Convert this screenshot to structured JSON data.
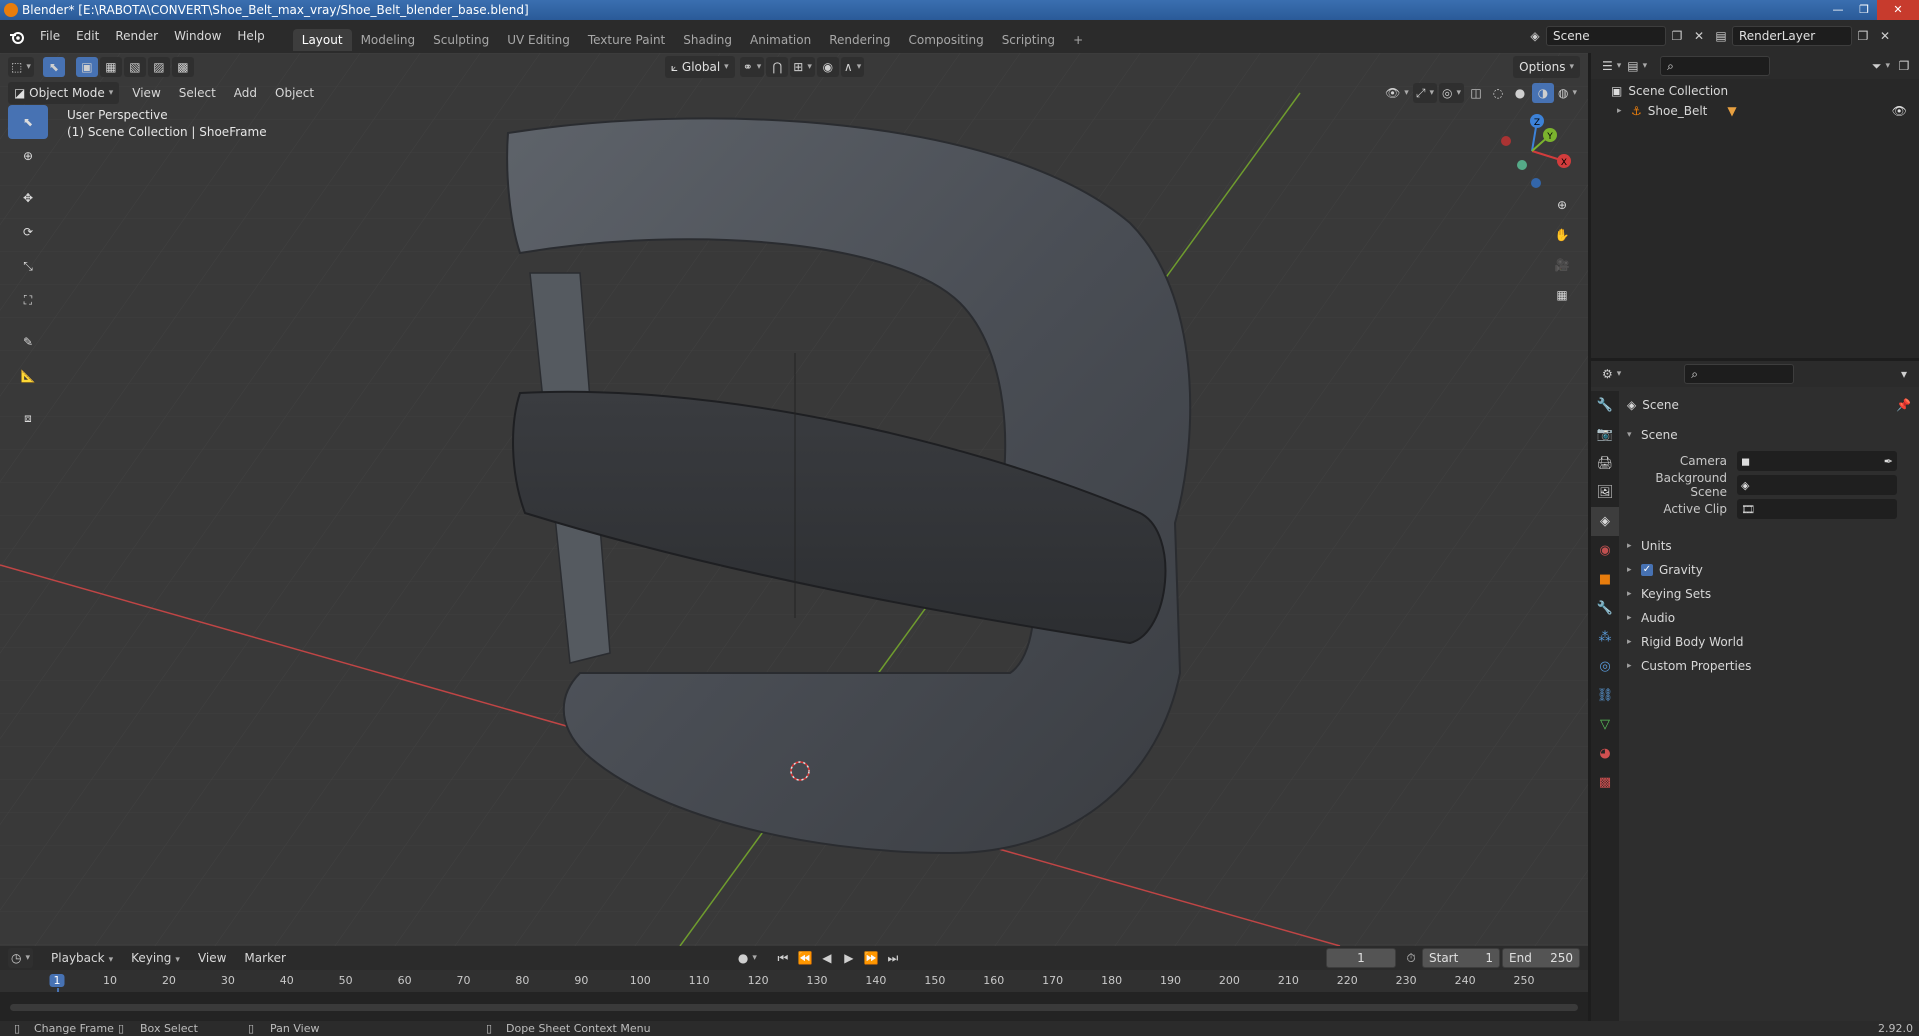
{
  "window": {
    "title": "Blender* [E:\\RABOTA\\CONVERT\\Shoe_Belt_max_vray/Shoe_Belt_blender_base.blend]",
    "controls": [
      "—",
      "❐",
      "✕"
    ]
  },
  "menu": {
    "items": [
      "File",
      "Edit",
      "Render",
      "Window",
      "Help"
    ]
  },
  "workspaces": {
    "tabs": [
      "Layout",
      "Modeling",
      "Sculpting",
      "UV Editing",
      "Texture Paint",
      "Shading",
      "Animation",
      "Rendering",
      "Compositing",
      "Scripting"
    ],
    "active": "Layout",
    "add": "+"
  },
  "scene_selector": {
    "value": "Scene"
  },
  "renderlayer_selector": {
    "value": "RenderLayer"
  },
  "viewport": {
    "mode": "Object Mode",
    "menus": [
      "View",
      "Select",
      "Add",
      "Object"
    ],
    "transform_orientation": "Global",
    "options_label": "Options",
    "info_line1": "User Perspective",
    "info_line2": "(1) Scene Collection | ShoeFrame"
  },
  "outliner": {
    "root": "Scene Collection",
    "items": [
      {
        "name": "Shoe_Belt"
      }
    ]
  },
  "properties": {
    "context": "Scene",
    "panel_title": "Scene",
    "fields": [
      {
        "label": "Camera",
        "value": ""
      },
      {
        "label": "Background Scene",
        "value": ""
      },
      {
        "label": "Active Clip",
        "value": ""
      }
    ],
    "collapsed_panels": [
      "Units",
      "Gravity",
      "Keying Sets",
      "Audio",
      "Rigid Body World",
      "Custom Properties"
    ],
    "gravity_checked": true
  },
  "timeline": {
    "menus": [
      "Playback",
      "Keying",
      "View",
      "Marker"
    ],
    "current_frame": "1",
    "start_label": "Start",
    "start_value": "1",
    "end_label": "End",
    "end_value": "250",
    "ticks": [
      "1",
      "10",
      "20",
      "30",
      "40",
      "50",
      "60",
      "70",
      "80",
      "90",
      "100",
      "110",
      "120",
      "130",
      "140",
      "150",
      "160",
      "170",
      "180",
      "190",
      "200",
      "210",
      "220",
      "230",
      "240",
      "250"
    ]
  },
  "statusbar": {
    "items": [
      "Change Frame",
      "Box Select",
      "Pan View",
      "Dope Sheet Context Menu"
    ],
    "version": "2.92.0"
  },
  "colors": {
    "accent": "#4772b3",
    "x_axis": "#d23c3c",
    "y_axis": "#7bb32e",
    "z_axis": "#3d82d8",
    "object": "#e87d0d"
  }
}
